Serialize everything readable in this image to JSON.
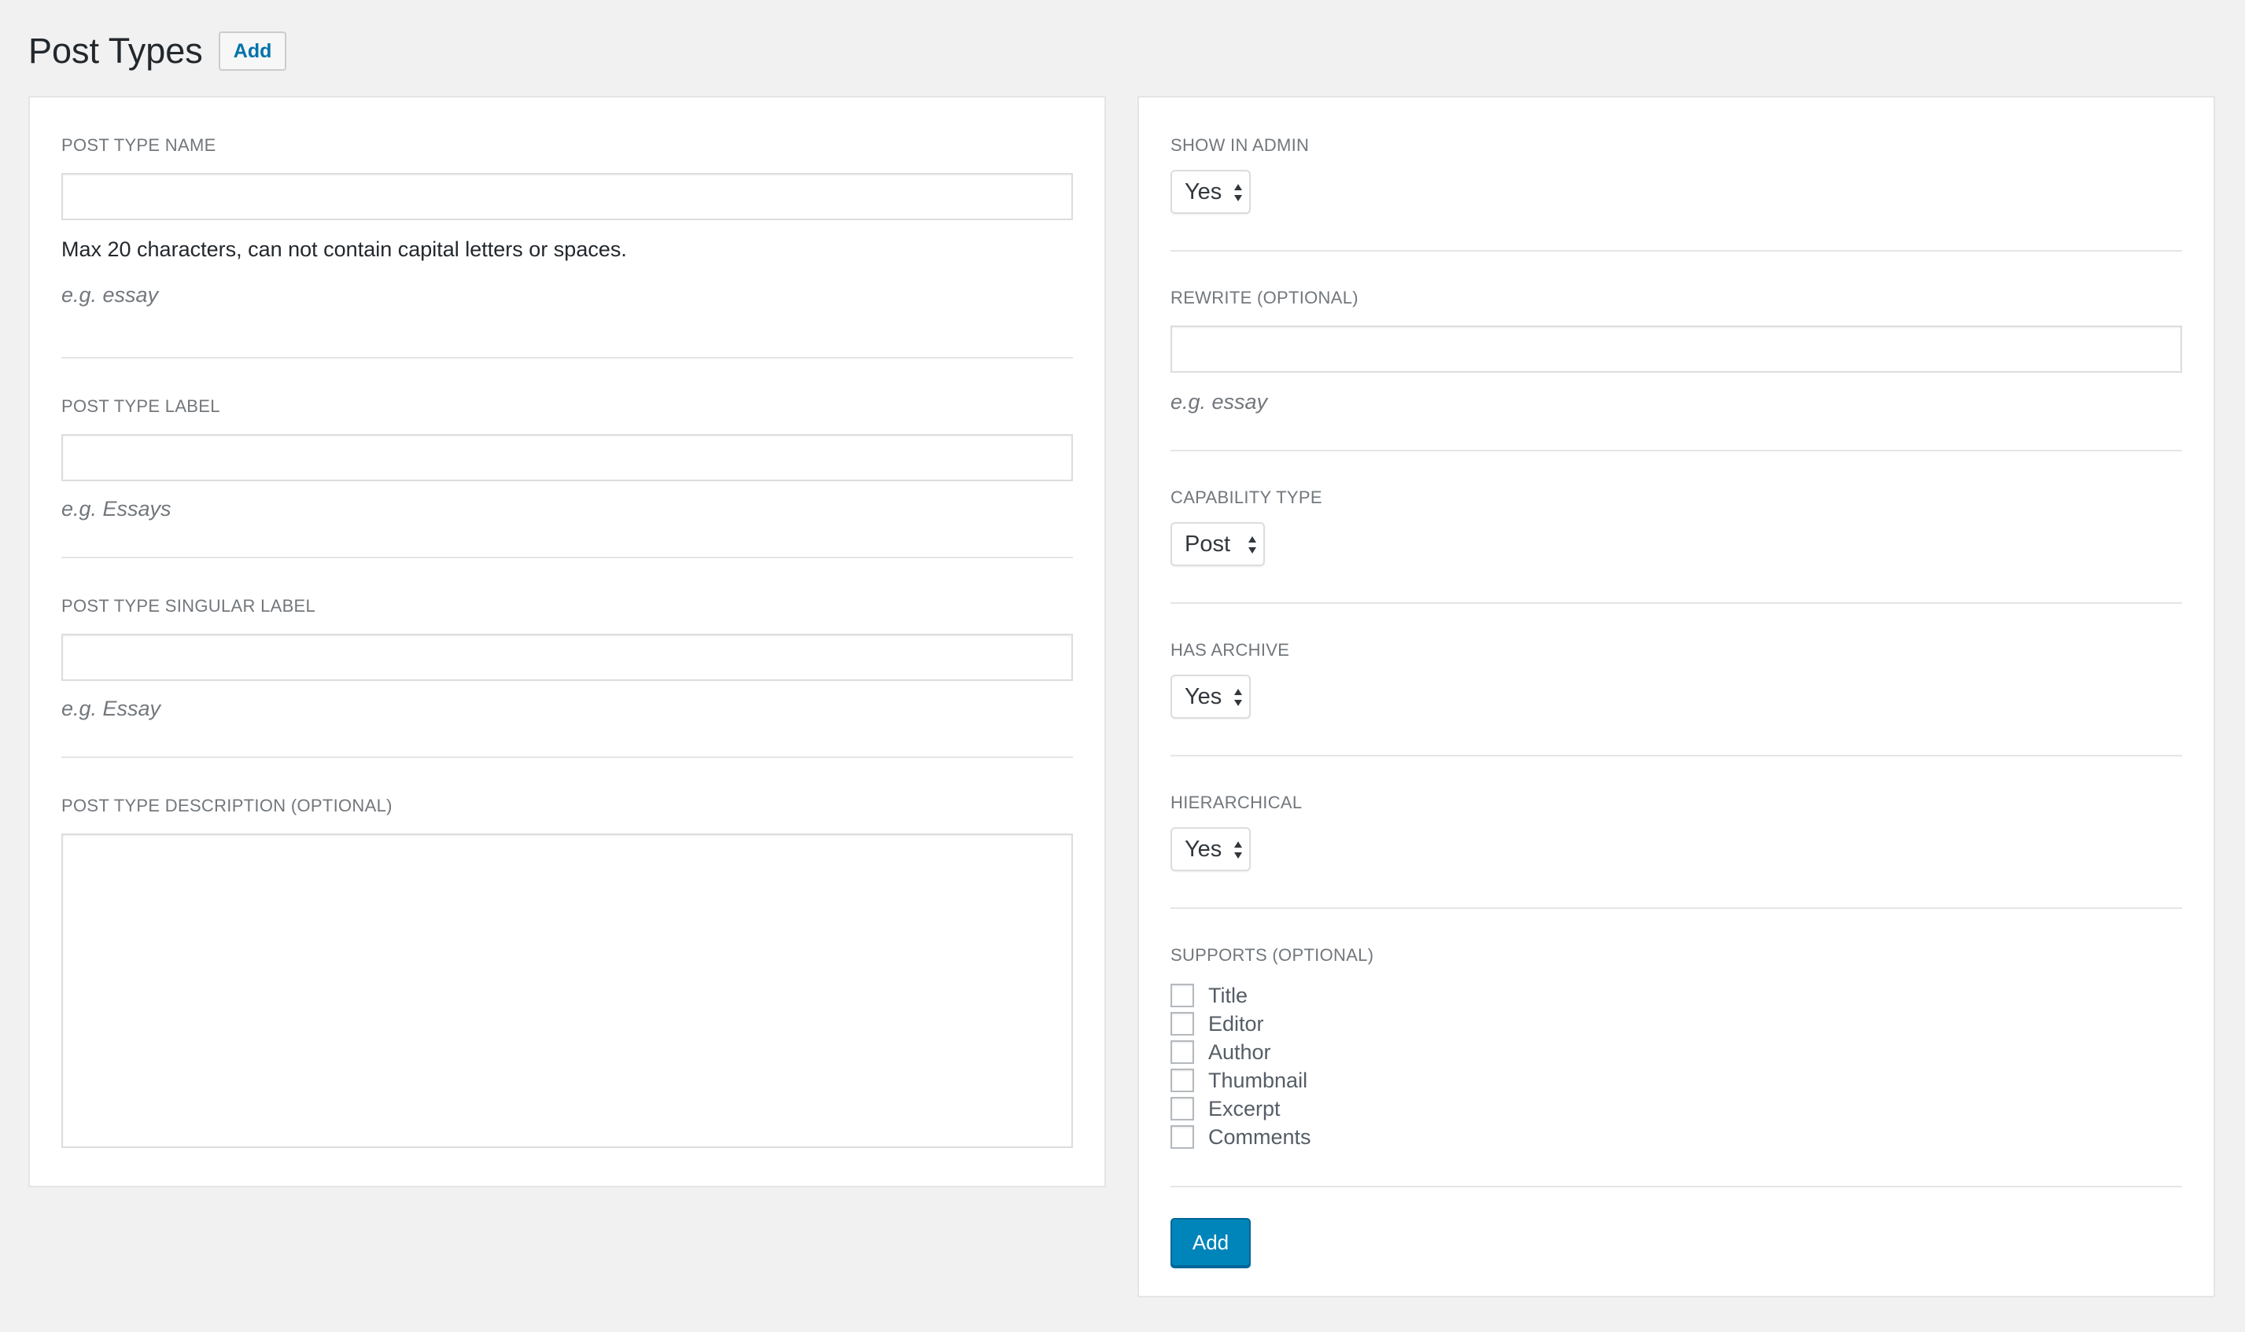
{
  "header": {
    "title": "Post Types",
    "add_button": "Add"
  },
  "left_form": {
    "name": {
      "label": "POST TYPE NAME",
      "value": "",
      "help": "Max 20 characters, can not contain capital letters or spaces.",
      "example": "e.g. essay"
    },
    "label": {
      "label": "POST TYPE LABEL",
      "value": "",
      "example": "e.g. Essays"
    },
    "singular_label": {
      "label": "POST TYPE SINGULAR LABEL",
      "value": "",
      "example": "e.g. Essay"
    },
    "description": {
      "label": "POST TYPE DESCRIPTION (OPTIONAL)",
      "value": ""
    }
  },
  "right_form": {
    "show_in_admin": {
      "label": "SHOW IN ADMIN",
      "value": "Yes"
    },
    "rewrite": {
      "label": "REWRITE (OPTIONAL)",
      "value": "",
      "example": "e.g. essay"
    },
    "capability_type": {
      "label": "CAPABILITY TYPE",
      "value": "Post"
    },
    "has_archive": {
      "label": "HAS ARCHIVE",
      "value": "Yes"
    },
    "hierarchical": {
      "label": "HIERARCHICAL",
      "value": "Yes"
    },
    "supports": {
      "label": "SUPPORTS (OPTIONAL)",
      "options": [
        {
          "label": "Title",
          "checked": false
        },
        {
          "label": "Editor",
          "checked": false
        },
        {
          "label": "Author",
          "checked": false
        },
        {
          "label": "Thumbnail",
          "checked": false
        },
        {
          "label": "Excerpt",
          "checked": false
        },
        {
          "label": "Comments",
          "checked": false
        }
      ]
    },
    "submit_button": "Add"
  },
  "colors": {
    "accent": "#0073aa",
    "primary_button": "#0085ba",
    "background": "#f1f1f1",
    "panel": "#ffffff",
    "label_text": "#72777c"
  }
}
